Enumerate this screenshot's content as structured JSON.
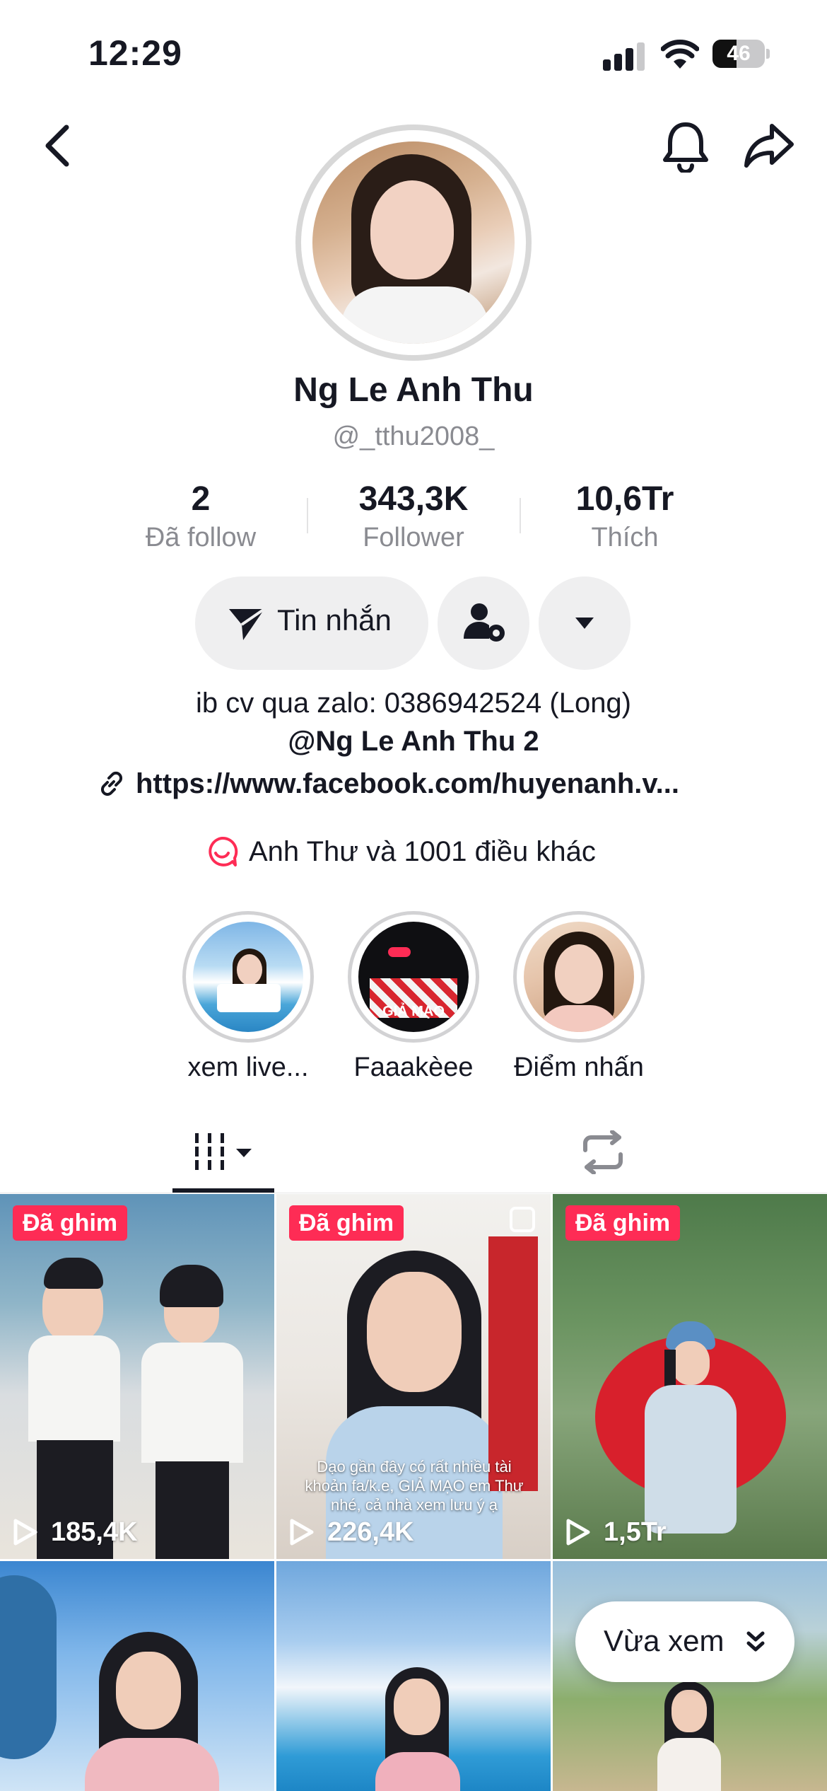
{
  "status_bar": {
    "time": "12:29",
    "battery_level": 46,
    "battery_text": "46"
  },
  "icons": {
    "back": "chevron-left-icon",
    "notifications": "bell-icon",
    "share": "share-arrow-icon",
    "message": "send-icon",
    "add_friend": "person-settings-icon",
    "more": "caret-down-icon",
    "link": "link-icon",
    "group": "chat-group-icon",
    "grid_tab": "grid-icon",
    "repost_tab": "repost-icon",
    "play": "play-icon",
    "expand": "double-chevron-down-icon"
  },
  "colors": {
    "accent": "#fe2c55",
    "text_primary": "#161823",
    "text_secondary": "#8a8b91",
    "button_bg": "#efeff0"
  },
  "profile": {
    "name": "Ng Le Anh Thu",
    "handle": "@_tthu2008_"
  },
  "stats": [
    {
      "value": "2",
      "label": "Đã follow"
    },
    {
      "value": "343,3K",
      "label": "Follower"
    },
    {
      "value": "10,6Tr",
      "label": "Thích"
    }
  ],
  "actions": {
    "message_label": "Tin nhắn"
  },
  "bio": {
    "line1": "ib cv qua zalo: 0386942524 (Long)",
    "line2": "@Ng Le Anh Thu 2",
    "link": "https://www.facebook.com/huyenanh.v..."
  },
  "group": {
    "label": "Anh Thư và 1001 điều khác"
  },
  "highlights": [
    {
      "label": "xem live..."
    },
    {
      "label": "Faaakèee",
      "image_text": "GIẢ MẠO"
    },
    {
      "label": "Điểm nhấn"
    }
  ],
  "videos": [
    {
      "badge": "Đã ghim",
      "views": "185,4K"
    },
    {
      "badge": "Đã ghim",
      "views": "226,4K",
      "caption": "Dạo gần đây có rất nhiều tài khoản fa/k.e, GIẢ MẠO em Thư nhé, cả nhà xem lưu ý ạ"
    },
    {
      "badge": "Đã ghim",
      "views": "1,5Tr"
    },
    {
      "views": ""
    },
    {
      "views": ""
    },
    {
      "views": ""
    }
  ],
  "recent_button": {
    "label": "Vừa xem"
  }
}
